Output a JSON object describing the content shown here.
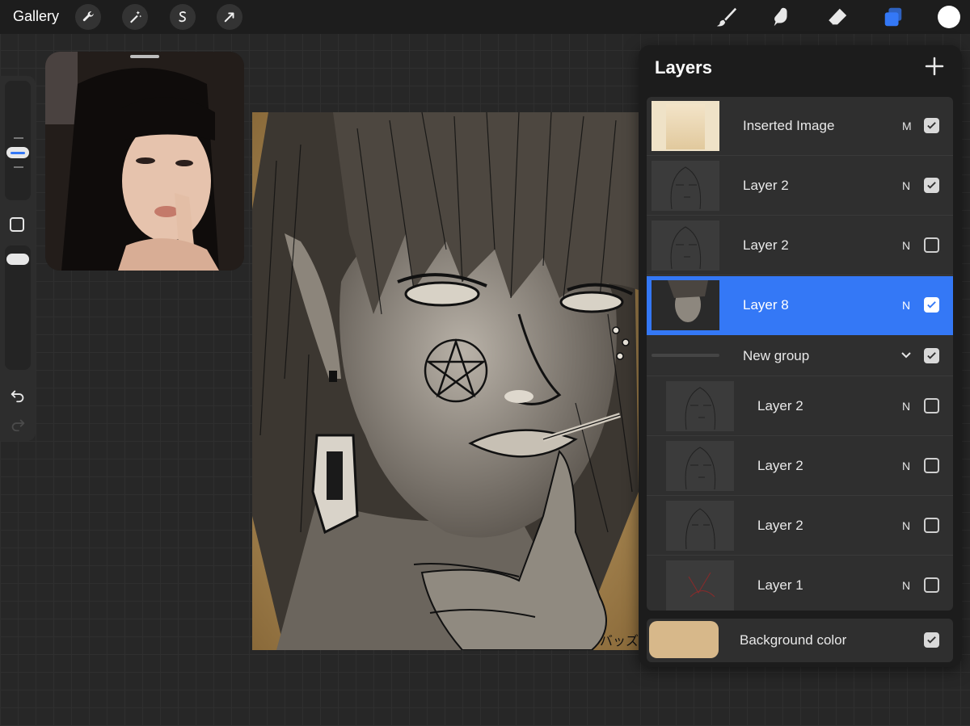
{
  "app": {
    "gallery_label": "Gallery",
    "top_tools": [
      "wrench-icon",
      "magic-wand-icon",
      "selection-icon",
      "transform-arrow-icon"
    ],
    "right_tools": [
      "brush-icon",
      "smudge-icon",
      "eraser-icon",
      "layers-icon"
    ],
    "active_color": "#ffffff",
    "accent": "#3478f6"
  },
  "layers_panel": {
    "title": "Layers",
    "layers": [
      {
        "name": "Inserted Image",
        "blend": "M",
        "visible": true,
        "selected": false
      },
      {
        "name": "Layer 2",
        "blend": "N",
        "visible": true,
        "selected": false
      },
      {
        "name": "Layer 2",
        "blend": "N",
        "visible": false,
        "selected": false
      },
      {
        "name": "Layer 8",
        "blend": "N",
        "visible": true,
        "selected": true
      }
    ],
    "group": {
      "name": "New group",
      "visible": true,
      "expanded": true
    },
    "group_layers": [
      {
        "name": "Layer 2",
        "blend": "N",
        "visible": false
      },
      {
        "name": "Layer 2",
        "blend": "N",
        "visible": false
      },
      {
        "name": "Layer 2",
        "blend": "N",
        "visible": false
      },
      {
        "name": "Layer 1",
        "blend": "N",
        "visible": false
      }
    ],
    "background": {
      "label": "Background color",
      "color": "#d7b88a",
      "visible": true
    }
  },
  "canvas": {
    "signature": "バッズ"
  }
}
